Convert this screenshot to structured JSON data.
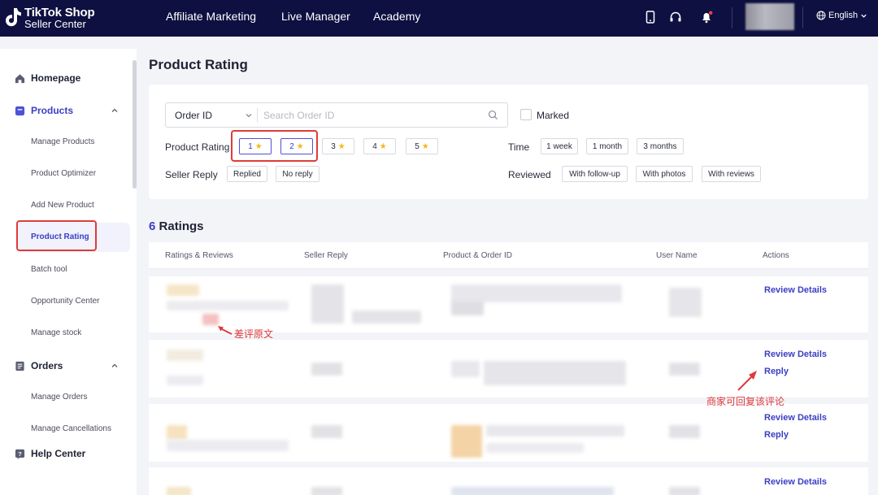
{
  "header": {
    "logo_line1": "TikTok Shop",
    "logo_line2": "Seller Center",
    "nav": [
      "Affiliate Marketing",
      "Live Manager",
      "Academy"
    ],
    "language": "English",
    "icons": [
      "phone-icon",
      "headset-icon",
      "bell-icon",
      "globe-icon"
    ],
    "colors": {
      "bar": "#0d1040",
      "notification_dot": "#ff3b4a"
    }
  },
  "sidebar": {
    "homepage": "Homepage",
    "products": {
      "label": "Products",
      "items": [
        "Manage Products",
        "Product Optimizer",
        "Add New Product",
        "Product Rating",
        "Batch tool",
        "Opportunity Center",
        "Manage stock"
      ]
    },
    "orders": {
      "label": "Orders",
      "items": [
        "Manage Orders",
        "Manage Cancellations"
      ]
    },
    "help": "Help Center",
    "active_item": "Product Rating"
  },
  "page": {
    "title": "Product Rating"
  },
  "filters": {
    "search_select": "Order ID",
    "search_placeholder": "Search Order ID",
    "marked_label": "Marked",
    "product_rating_label": "Product Rating",
    "ratings": [
      "1",
      "2",
      "3",
      "4",
      "5"
    ],
    "selected_ratings": [
      "1",
      "2"
    ],
    "time_label": "Time",
    "time_options": [
      "1 week",
      "1 month",
      "3 months"
    ],
    "seller_reply_label": "Seller Reply",
    "reply_options": [
      "Replied",
      "No reply"
    ],
    "reviewed_label": "Reviewed",
    "reviewed_options": [
      "With follow-up",
      "With photos",
      "With reviews"
    ]
  },
  "results": {
    "count": "6",
    "label": "Ratings",
    "columns": [
      "Ratings & Reviews",
      "Seller Reply",
      "Product & Order ID",
      "User Name",
      "Actions"
    ],
    "rows": [
      {
        "actions": [
          "Review Details"
        ]
      },
      {
        "actions": [
          "Review Details",
          "Reply"
        ]
      },
      {
        "actions": [
          "Review Details",
          "Reply"
        ]
      },
      {
        "actions": [
          "Review Details"
        ]
      }
    ]
  },
  "annotations": {
    "bad_review": "差评原文",
    "merchant_reply": "商家可回复该评论",
    "color": "#e03a3a"
  },
  "colors": {
    "accent": "#3a3fc4",
    "star": "#f5b81c"
  }
}
